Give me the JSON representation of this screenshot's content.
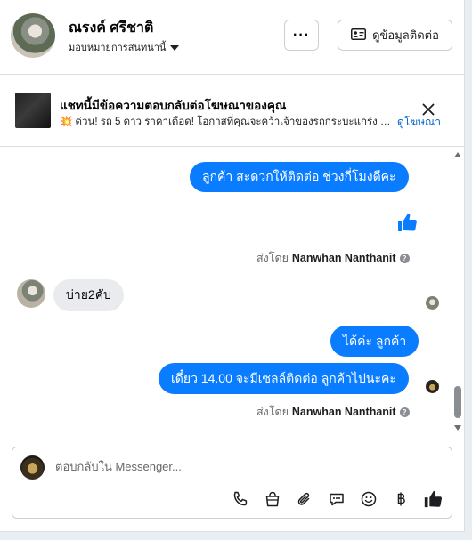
{
  "header": {
    "contact_name": "ณรงค์ ศรีชาติ",
    "assign_label": "มอบหมายการสนทนานี้",
    "more_label": "···",
    "contact_info_label": "ดูข้อมูลติดต่อ"
  },
  "ad_banner": {
    "title": "แชทนี้มีข้อความตอบกลับต่อโฆษณาของคุณ",
    "spark": "💥",
    "subtitle": "ด่วน! รถ 5 ดาว ราคาเดือด! โอกาสที่คุณจะคว้าเจ้าของรถกระบะแกร่ง Toy...",
    "link": "ดูโฆษณา"
  },
  "messages": [
    {
      "id": "m1",
      "direction": "outgoing",
      "text": "ลูกค้า  สะดวกให้ติดต่อ ช่วงกี่โมงดีคะ"
    },
    {
      "id": "m2",
      "direction": "outgoing",
      "type": "like"
    },
    {
      "id": "s1",
      "type": "sent_by",
      "prefix": "ส่งโดย",
      "name": "Nanwhan Nanthanit"
    },
    {
      "id": "m3",
      "direction": "incoming",
      "text": "บ่าย2คับ"
    },
    {
      "id": "m4",
      "direction": "outgoing",
      "text": "ได้ค่ะ  ลูกค้า"
    },
    {
      "id": "m5",
      "direction": "outgoing",
      "text": "เดี๋ยว 14.00 จะมีเซลล์ติดต่อ ลูกค้าไปนะคะ"
    },
    {
      "id": "s2",
      "type": "sent_by",
      "prefix": "ส่งโดย",
      "name": "Nanwhan Nanthanit"
    }
  ],
  "composer": {
    "placeholder": "ตอบกลับใน Messenger...",
    "tools": [
      "phone-icon",
      "shopping-bag-icon",
      "paperclip-icon",
      "saved-reply-icon",
      "emoji-icon",
      "baht-icon",
      "thumbs-up-icon"
    ]
  },
  "colors": {
    "outgoing_bubble": "#0a7cff",
    "incoming_bubble": "#e9ebee",
    "link": "#0064d1"
  }
}
